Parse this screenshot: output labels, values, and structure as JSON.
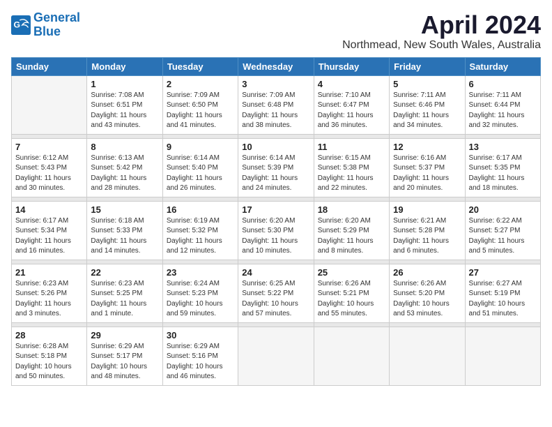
{
  "header": {
    "logo_line1": "General",
    "logo_line2": "Blue",
    "month_year": "April 2024",
    "location": "Northmead, New South Wales, Australia"
  },
  "weekdays": [
    "Sunday",
    "Monday",
    "Tuesday",
    "Wednesday",
    "Thursday",
    "Friday",
    "Saturday"
  ],
  "weeks": [
    [
      {
        "day": "",
        "empty": true
      },
      {
        "day": "1",
        "sunrise": "7:08 AM",
        "sunset": "6:51 PM",
        "daylight": "11 hours and 43 minutes."
      },
      {
        "day": "2",
        "sunrise": "7:09 AM",
        "sunset": "6:50 PM",
        "daylight": "11 hours and 41 minutes."
      },
      {
        "day": "3",
        "sunrise": "7:09 AM",
        "sunset": "6:48 PM",
        "daylight": "11 hours and 38 minutes."
      },
      {
        "day": "4",
        "sunrise": "7:10 AM",
        "sunset": "6:47 PM",
        "daylight": "11 hours and 36 minutes."
      },
      {
        "day": "5",
        "sunrise": "7:11 AM",
        "sunset": "6:46 PM",
        "daylight": "11 hours and 34 minutes."
      },
      {
        "day": "6",
        "sunrise": "7:11 AM",
        "sunset": "6:44 PM",
        "daylight": "11 hours and 32 minutes."
      }
    ],
    [
      {
        "day": "7",
        "sunrise": "6:12 AM",
        "sunset": "5:43 PM",
        "daylight": "11 hours and 30 minutes."
      },
      {
        "day": "8",
        "sunrise": "6:13 AM",
        "sunset": "5:42 PM",
        "daylight": "11 hours and 28 minutes."
      },
      {
        "day": "9",
        "sunrise": "6:14 AM",
        "sunset": "5:40 PM",
        "daylight": "11 hours and 26 minutes."
      },
      {
        "day": "10",
        "sunrise": "6:14 AM",
        "sunset": "5:39 PM",
        "daylight": "11 hours and 24 minutes."
      },
      {
        "day": "11",
        "sunrise": "6:15 AM",
        "sunset": "5:38 PM",
        "daylight": "11 hours and 22 minutes."
      },
      {
        "day": "12",
        "sunrise": "6:16 AM",
        "sunset": "5:37 PM",
        "daylight": "11 hours and 20 minutes."
      },
      {
        "day": "13",
        "sunrise": "6:17 AM",
        "sunset": "5:35 PM",
        "daylight": "11 hours and 18 minutes."
      }
    ],
    [
      {
        "day": "14",
        "sunrise": "6:17 AM",
        "sunset": "5:34 PM",
        "daylight": "11 hours and 16 minutes."
      },
      {
        "day": "15",
        "sunrise": "6:18 AM",
        "sunset": "5:33 PM",
        "daylight": "11 hours and 14 minutes."
      },
      {
        "day": "16",
        "sunrise": "6:19 AM",
        "sunset": "5:32 PM",
        "daylight": "11 hours and 12 minutes."
      },
      {
        "day": "17",
        "sunrise": "6:20 AM",
        "sunset": "5:30 PM",
        "daylight": "11 hours and 10 minutes."
      },
      {
        "day": "18",
        "sunrise": "6:20 AM",
        "sunset": "5:29 PM",
        "daylight": "11 hours and 8 minutes."
      },
      {
        "day": "19",
        "sunrise": "6:21 AM",
        "sunset": "5:28 PM",
        "daylight": "11 hours and 6 minutes."
      },
      {
        "day": "20",
        "sunrise": "6:22 AM",
        "sunset": "5:27 PM",
        "daylight": "11 hours and 5 minutes."
      }
    ],
    [
      {
        "day": "21",
        "sunrise": "6:23 AM",
        "sunset": "5:26 PM",
        "daylight": "11 hours and 3 minutes."
      },
      {
        "day": "22",
        "sunrise": "6:23 AM",
        "sunset": "5:25 PM",
        "daylight": "11 hours and 1 minute."
      },
      {
        "day": "23",
        "sunrise": "6:24 AM",
        "sunset": "5:23 PM",
        "daylight": "10 hours and 59 minutes."
      },
      {
        "day": "24",
        "sunrise": "6:25 AM",
        "sunset": "5:22 PM",
        "daylight": "10 hours and 57 minutes."
      },
      {
        "day": "25",
        "sunrise": "6:26 AM",
        "sunset": "5:21 PM",
        "daylight": "10 hours and 55 minutes."
      },
      {
        "day": "26",
        "sunrise": "6:26 AM",
        "sunset": "5:20 PM",
        "daylight": "10 hours and 53 minutes."
      },
      {
        "day": "27",
        "sunrise": "6:27 AM",
        "sunset": "5:19 PM",
        "daylight": "10 hours and 51 minutes."
      }
    ],
    [
      {
        "day": "28",
        "sunrise": "6:28 AM",
        "sunset": "5:18 PM",
        "daylight": "10 hours and 50 minutes."
      },
      {
        "day": "29",
        "sunrise": "6:29 AM",
        "sunset": "5:17 PM",
        "daylight": "10 hours and 48 minutes."
      },
      {
        "day": "30",
        "sunrise": "6:29 AM",
        "sunset": "5:16 PM",
        "daylight": "10 hours and 46 minutes."
      },
      {
        "day": "",
        "empty": true
      },
      {
        "day": "",
        "empty": true
      },
      {
        "day": "",
        "empty": true
      },
      {
        "day": "",
        "empty": true
      }
    ]
  ],
  "labels": {
    "sunrise_prefix": "Sunrise: ",
    "sunset_prefix": "Sunset: ",
    "daylight_prefix": "Daylight: "
  }
}
